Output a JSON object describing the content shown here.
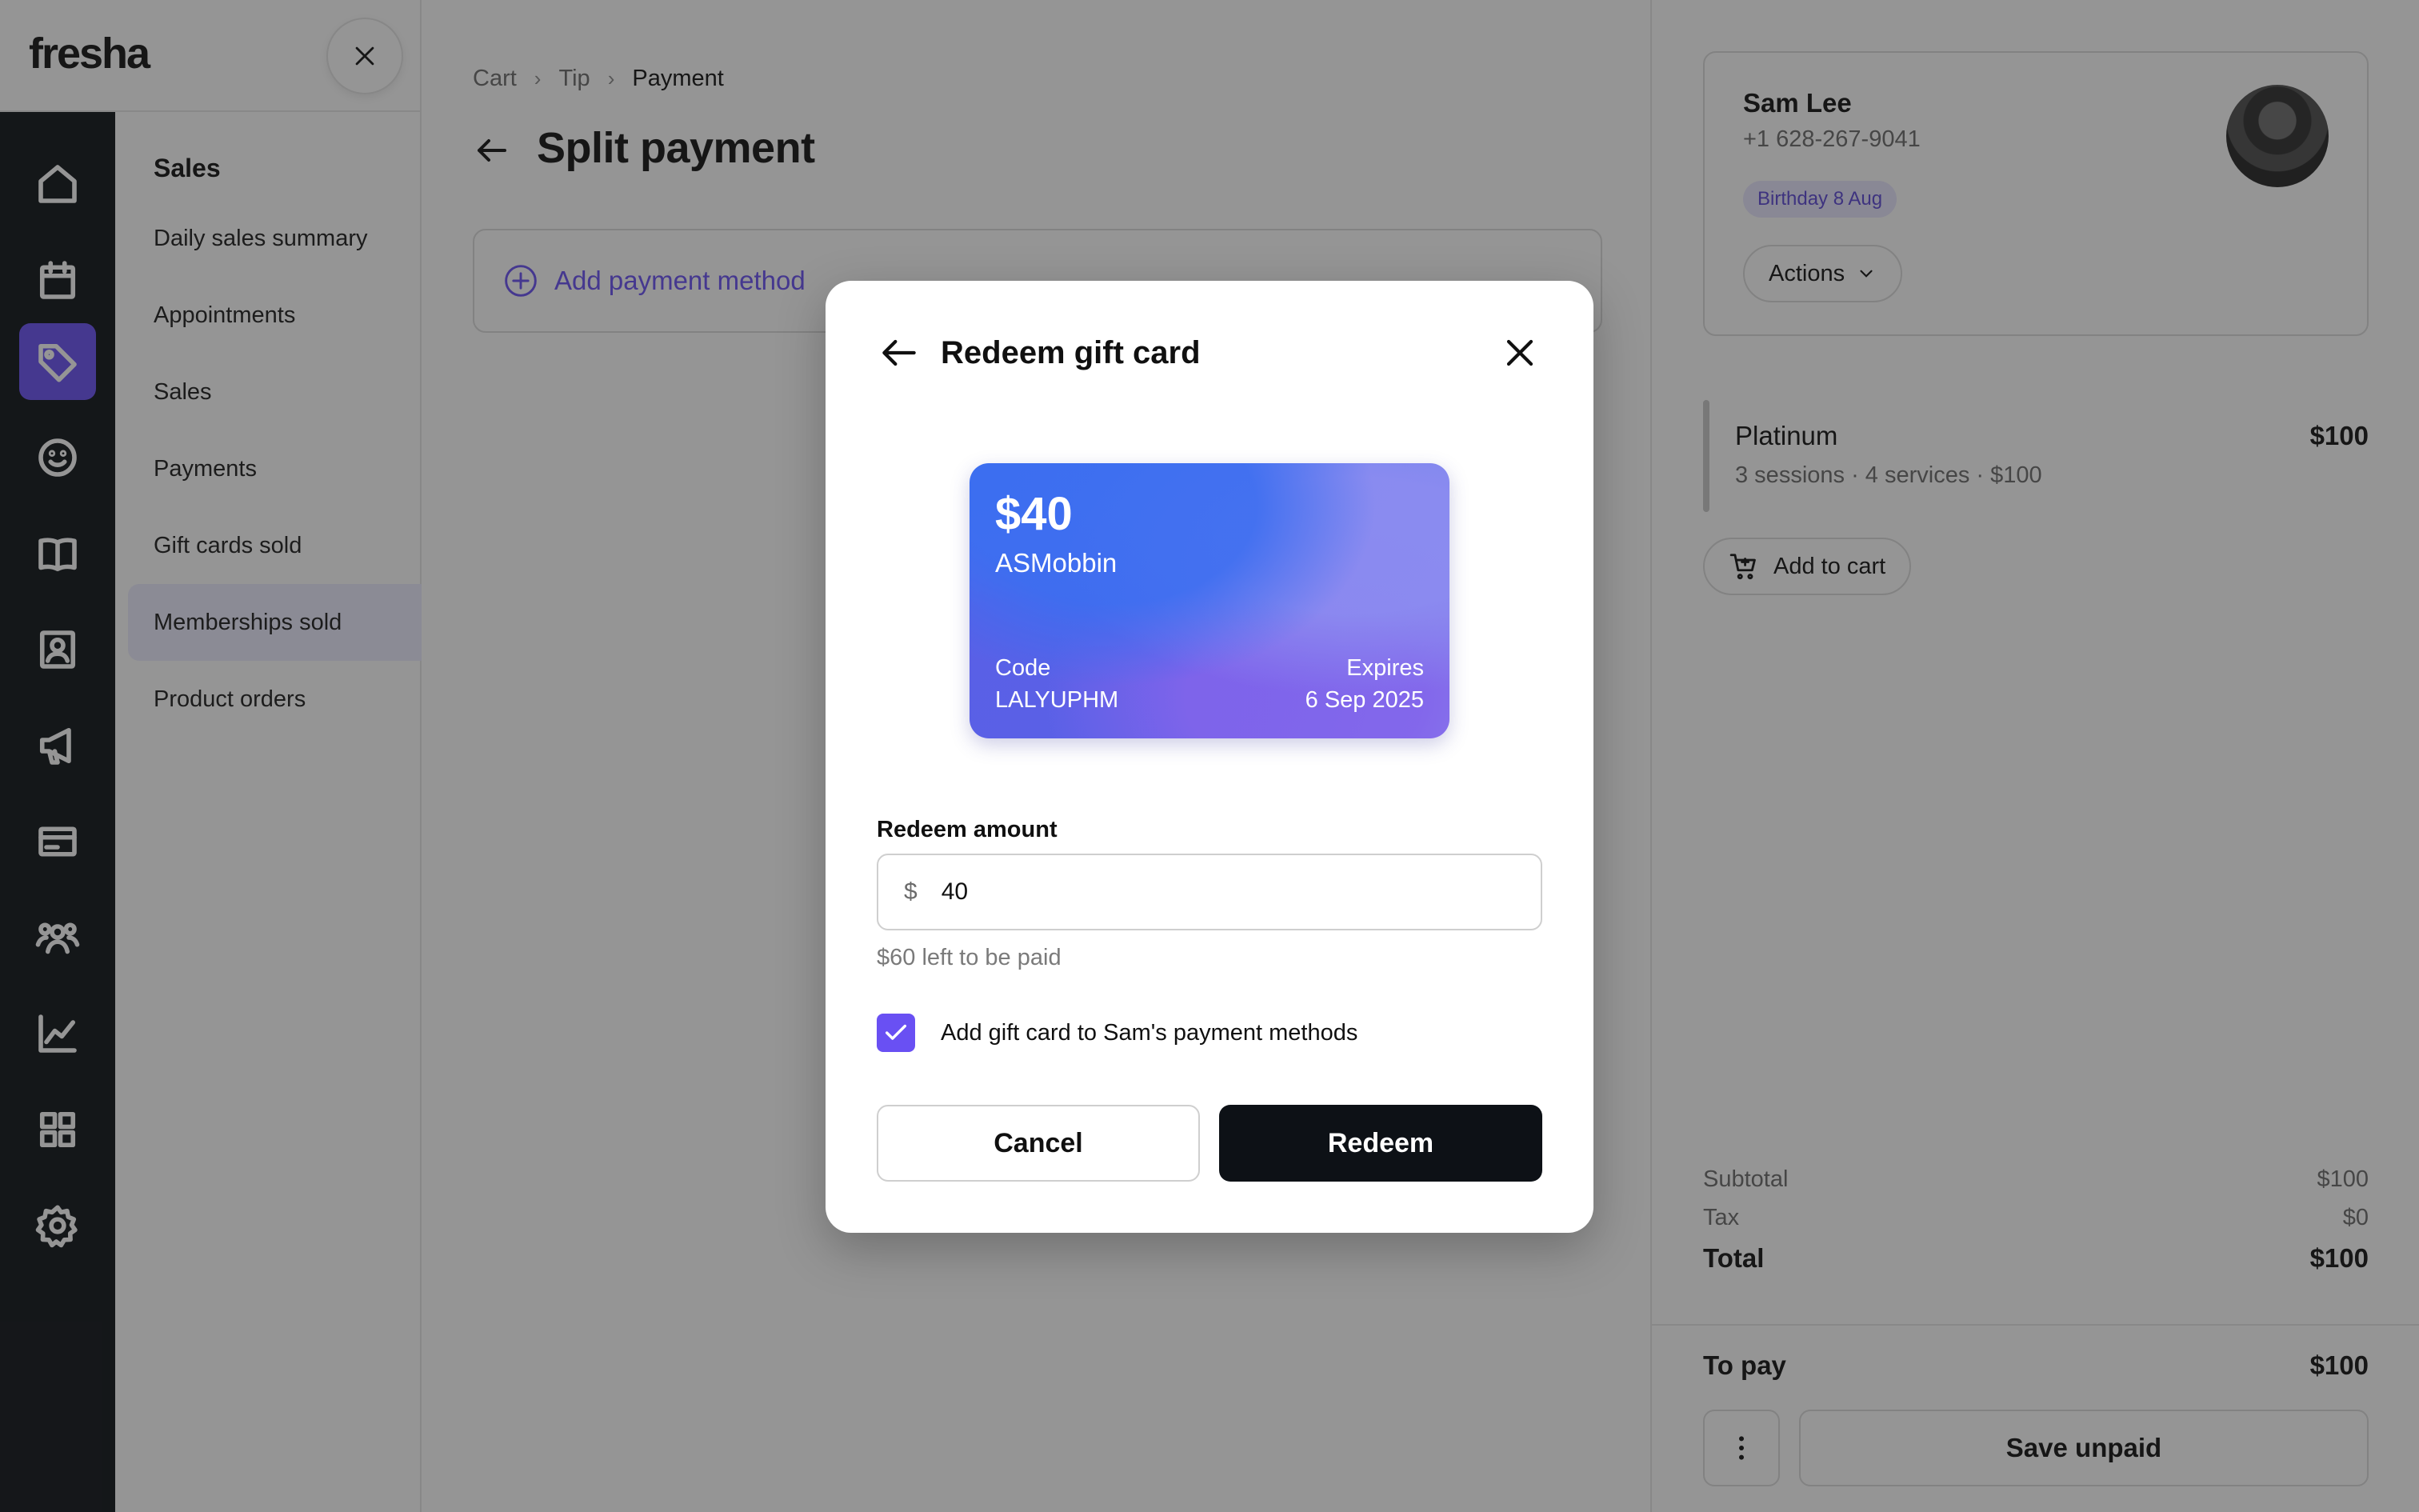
{
  "brand": {
    "logo": "fresha",
    "close_icon": "close-icon"
  },
  "rail": {
    "items": [
      {
        "icon": "home-icon",
        "active": false
      },
      {
        "icon": "calendar-icon",
        "active": false
      },
      {
        "icon": "tag-icon",
        "active": true
      },
      {
        "icon": "smiley-icon",
        "active": false
      },
      {
        "icon": "book-icon",
        "active": false
      },
      {
        "icon": "contact-card-icon",
        "active": false
      },
      {
        "icon": "megaphone-icon",
        "active": false
      },
      {
        "icon": "payment-card-icon",
        "active": false
      },
      {
        "icon": "team-icon",
        "active": false
      },
      {
        "icon": "chart-icon",
        "active": false
      },
      {
        "icon": "grid-icon",
        "active": false
      },
      {
        "icon": "gear-icon",
        "active": false
      }
    ],
    "accent": "#6950f3"
  },
  "subnav": {
    "title": "Sales",
    "items": [
      {
        "label": "Daily sales summary",
        "active": false
      },
      {
        "label": "Appointments",
        "active": false
      },
      {
        "label": "Sales",
        "active": false
      },
      {
        "label": "Payments",
        "active": false
      },
      {
        "label": "Gift cards sold",
        "active": false
      },
      {
        "label": "Memberships sold",
        "active": true
      },
      {
        "label": "Product orders",
        "active": false
      }
    ]
  },
  "main": {
    "breadcrumb": [
      "Cart",
      "Tip",
      "Payment"
    ],
    "title": "Split payment",
    "add_payment_label": "Add payment method"
  },
  "client": {
    "name": "Sam Lee",
    "phone": "+1 628-267-9041",
    "birthday": "Birthday 8 Aug",
    "actions_label": "Actions"
  },
  "cart_item": {
    "name": "Platinum",
    "meta": "3 sessions · 4 services · $100",
    "price": "$100",
    "add_to_cart": "Add to cart"
  },
  "summary": {
    "subtotal_label": "Subtotal",
    "subtotal": "$100",
    "tax_label": "Tax",
    "tax": "$0",
    "total_label": "Total",
    "total": "$100",
    "topay_label": "To pay",
    "topay": "$100",
    "save_unpaid": "Save unpaid"
  },
  "modal": {
    "title": "Redeem gift card",
    "card": {
      "amount": "$40",
      "owner": "ASMobbin",
      "code_label": "Code",
      "code": "LALYUPHM",
      "expires_label": "Expires",
      "expires": "6 Sep 2025"
    },
    "amount_label": "Redeem amount",
    "currency": "$",
    "amount_value": "40",
    "left_to_pay": "$60 left to be paid",
    "checkbox_label": "Add gift card to Sam's payment methods",
    "checkbox_checked": true,
    "cancel_label": "Cancel",
    "redeem_label": "Redeem"
  }
}
